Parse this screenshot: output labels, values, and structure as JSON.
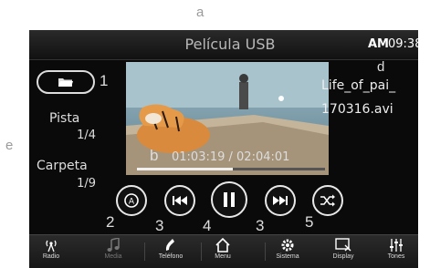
{
  "callouts": {
    "a": "a",
    "b": "b",
    "d": "d",
    "e": "e",
    "n1": "1",
    "n2": "2",
    "n3a": "3",
    "n4": "4",
    "n3b": "3",
    "n5": "5"
  },
  "header": {
    "title": "Película USB",
    "am": "AM",
    "time": "09:38"
  },
  "track": {
    "pista_label": "Pista",
    "pista_value": "1/4",
    "carpeta_label": "Carpeta",
    "carpeta_value": "1/9"
  },
  "file": {
    "line1": "Life_of_pai_",
    "line2": "170316.avi"
  },
  "playback": {
    "time": "01:03:19 / 02:04:01",
    "progress": 0.51
  },
  "controls": [
    "auto-button",
    "previous",
    "pause",
    "next",
    "shuffle"
  ],
  "bottom_nav": [
    {
      "label": "Radio",
      "icon": "radio-antenna-icon",
      "active": true
    },
    {
      "label": "Media",
      "icon": "music-note-icon",
      "active": false
    },
    {
      "label": "Teléfono",
      "icon": "phone-icon",
      "active": true
    },
    {
      "label": "Menu",
      "icon": "home-icon",
      "active": true
    },
    {
      "label": "Sistema",
      "icon": "gear-icon",
      "active": true
    },
    {
      "label": "Display",
      "icon": "display-icon",
      "active": true
    },
    {
      "label": "Tones",
      "icon": "equalizer-icon",
      "active": true
    }
  ],
  "colors": {
    "background": "#0a0a0a",
    "text": "#dddddd",
    "accent": "#ffffff"
  }
}
